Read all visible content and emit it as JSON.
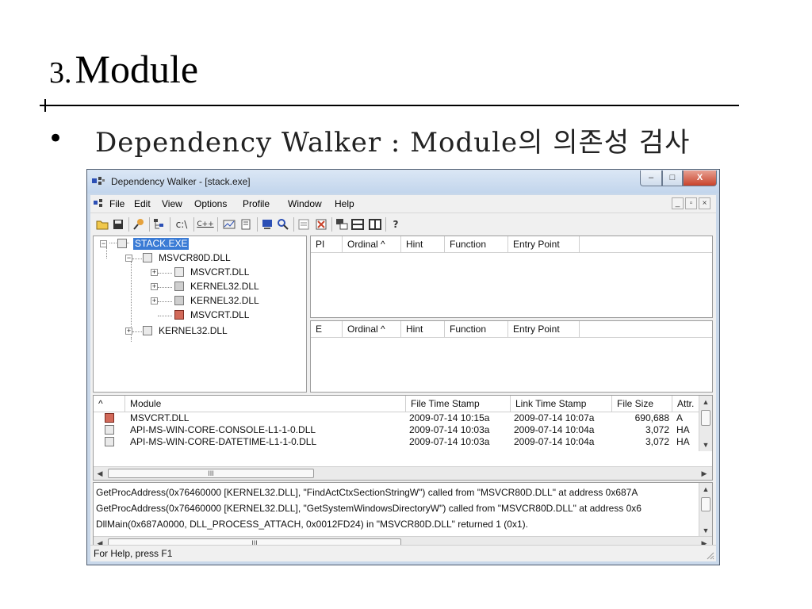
{
  "slide": {
    "number": "3.",
    "title": "Module",
    "bullet": "•",
    "subtitle": "Dependency Walker : Module의 의존성 검사"
  },
  "window": {
    "title": "Dependency Walker - [stack.exe]",
    "controls": {
      "minimize": "–",
      "maximize": "□",
      "close": "X"
    }
  },
  "menu": {
    "items": [
      "File",
      "Edit",
      "View",
      "Options",
      "Profile",
      "Window",
      "Help"
    ],
    "mdi": {
      "minimize": "_",
      "restore": "▫",
      "close": "×"
    }
  },
  "toolbar": {
    "tools": [
      "open-icon",
      "save-icon",
      "find-icon",
      "tree-icon",
      "path-icon",
      "cpp-icon",
      "chart-icon",
      "properties-icon",
      "module-icon",
      "search-icon",
      "list-icon",
      "highlight-icon",
      "tile-icon",
      "split-h-icon",
      "split-v-icon",
      "help-icon"
    ],
    "glyphs": {
      "path": "c:\\",
      "cpp": "C++",
      "help": "?"
    }
  },
  "tree": {
    "items": [
      {
        "label": "STACK.EXE",
        "type": "exe",
        "selected": true
      },
      {
        "label": "MSVCR80D.DLL",
        "type": "dll"
      },
      {
        "label": "MSVCRT.DLL",
        "type": "dll"
      },
      {
        "label": "KERNEL32.DLL",
        "type": "kernel"
      },
      {
        "label": "KERNEL32.DLL",
        "type": "kernel"
      },
      {
        "label": "MSVCRT.DLL",
        "type": "warning"
      },
      {
        "label": "KERNEL32.DLL",
        "type": "dll"
      }
    ]
  },
  "imports_pane": {
    "columns": [
      "PI",
      "Ordinal ^",
      "Hint",
      "Function",
      "Entry Point"
    ]
  },
  "exports_pane": {
    "columns": [
      "E",
      "Ordinal ^",
      "Hint",
      "Function",
      "Entry Point"
    ]
  },
  "module_list": {
    "columns": [
      "^",
      "Module",
      "File Time Stamp",
      "Link Time Stamp",
      "File Size",
      "Attr."
    ],
    "rows": [
      {
        "module": "MSVCRT.DLL",
        "file_ts": "2009-07-14 10:15a",
        "link_ts": "2009-07-14 10:07a",
        "size": "690,688",
        "attr": "A"
      },
      {
        "module": "API-MS-WIN-CORE-CONSOLE-L1-1-0.DLL",
        "file_ts": "2009-07-14 10:03a",
        "link_ts": "2009-07-14 10:04a",
        "size": "3,072",
        "attr": "HA"
      },
      {
        "module": "API-MS-WIN-CORE-DATETIME-L1-1-0.DLL",
        "file_ts": "2009-07-14 10:03a",
        "link_ts": "2009-07-14 10:04a",
        "size": "3,072",
        "attr": "HA"
      }
    ],
    "hscroll_grip": "III"
  },
  "log": {
    "lines": [
      "GetProcAddress(0x76460000 [KERNEL32.DLL], \"FindActCtxSectionStringW\") called from \"MSVCR80D.DLL\" at address 0x687A",
      "GetProcAddress(0x76460000 [KERNEL32.DLL], \"GetSystemWindowsDirectoryW\") called from \"MSVCR80D.DLL\" at address 0x6",
      "DllMain(0x687A0000, DLL_PROCESS_ATTACH, 0x0012FD24) in \"MSVCR80D.DLL\" returned 1 (0x1)."
    ],
    "hscroll_grip": "III"
  },
  "status": {
    "text": "For Help, press F1"
  },
  "colors": {
    "selection": "#3a7bd5",
    "close_button": "#c8432b",
    "frame": "#c9d8ea"
  }
}
